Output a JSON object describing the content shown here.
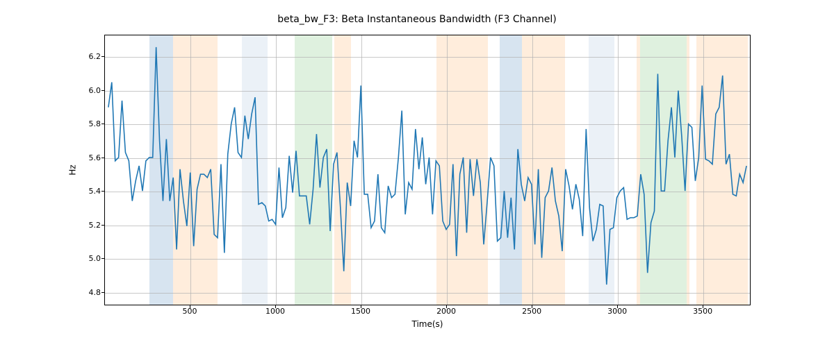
{
  "chart_data": {
    "type": "line",
    "title": "beta_bw_F3: Beta Instantaneous Bandwidth (F3 Channel)",
    "xlabel": "Time(s)",
    "ylabel": "Hz",
    "xlim": [
      0,
      3780
    ],
    "ylim": [
      4.72,
      6.33
    ],
    "xticks": [
      500,
      1000,
      1500,
      2000,
      2500,
      3000,
      3500
    ],
    "yticks": [
      4.8,
      5.0,
      5.2,
      5.4,
      5.6,
      5.8,
      6.0,
      6.2
    ],
    "grid": true,
    "bands": [
      {
        "x0": 260,
        "x1": 400,
        "color": "#a7c4de"
      },
      {
        "x0": 400,
        "x1": 660,
        "color": "#ffd8b1"
      },
      {
        "x0": 800,
        "x1": 950,
        "color": "#d3dfee"
      },
      {
        "x0": 1110,
        "x1": 1330,
        "color": "#b8e0b8"
      },
      {
        "x0": 1340,
        "x1": 1440,
        "color": "#ffd8b1"
      },
      {
        "x0": 1940,
        "x1": 2240,
        "color": "#ffd8b1"
      },
      {
        "x0": 2310,
        "x1": 2440,
        "color": "#a7c4de"
      },
      {
        "x0": 2440,
        "x1": 2690,
        "color": "#ffd8b1"
      },
      {
        "x0": 2830,
        "x1": 2980,
        "color": "#d3dfee"
      },
      {
        "x0": 3110,
        "x1": 3130,
        "color": "#ffd8b1"
      },
      {
        "x0": 3130,
        "x1": 3400,
        "color": "#b8e0b8"
      },
      {
        "x0": 3400,
        "x1": 3420,
        "color": "#ffd8b1"
      },
      {
        "x0": 3460,
        "x1": 3760,
        "color": "#ffd8b1"
      }
    ],
    "x": [
      20,
      40,
      60,
      80,
      100,
      120,
      140,
      160,
      180,
      200,
      220,
      240,
      260,
      280,
      300,
      320,
      340,
      360,
      380,
      400,
      420,
      440,
      460,
      480,
      500,
      520,
      540,
      560,
      580,
      600,
      620,
      640,
      660,
      680,
      700,
      720,
      740,
      760,
      780,
      800,
      820,
      840,
      860,
      880,
      900,
      920,
      940,
      960,
      980,
      1000,
      1020,
      1040,
      1060,
      1080,
      1100,
      1120,
      1140,
      1160,
      1180,
      1200,
      1220,
      1240,
      1260,
      1280,
      1300,
      1320,
      1340,
      1360,
      1380,
      1400,
      1420,
      1440,
      1460,
      1480,
      1500,
      1520,
      1540,
      1560,
      1580,
      1600,
      1620,
      1640,
      1660,
      1680,
      1700,
      1720,
      1740,
      1760,
      1780,
      1800,
      1820,
      1840,
      1860,
      1880,
      1900,
      1920,
      1940,
      1960,
      1980,
      2000,
      2020,
      2040,
      2060,
      2080,
      2100,
      2120,
      2140,
      2160,
      2180,
      2200,
      2220,
      2240,
      2260,
      2280,
      2300,
      2320,
      2340,
      2360,
      2380,
      2400,
      2420,
      2440,
      2460,
      2480,
      2500,
      2520,
      2540,
      2560,
      2580,
      2600,
      2620,
      2640,
      2660,
      2680,
      2700,
      2720,
      2740,
      2760,
      2780,
      2800,
      2820,
      2840,
      2860,
      2880,
      2900,
      2920,
      2940,
      2960,
      2980,
      3000,
      3020,
      3040,
      3060,
      3080,
      3100,
      3120,
      3140,
      3160,
      3180,
      3200,
      3220,
      3240,
      3260,
      3280,
      3300,
      3320,
      3340,
      3360,
      3380,
      3400,
      3420,
      3440,
      3460,
      3480,
      3500,
      3520,
      3540,
      3560,
      3580,
      3600,
      3620,
      3640,
      3660,
      3680,
      3700,
      3720,
      3740,
      3760
    ],
    "y": [
      5.9,
      6.05,
      5.58,
      5.6,
      5.94,
      5.63,
      5.58,
      5.34,
      5.46,
      5.55,
      5.4,
      5.58,
      5.6,
      5.6,
      6.26,
      5.7,
      5.34,
      5.71,
      5.34,
      5.48,
      5.05,
      5.53,
      5.34,
      5.19,
      5.51,
      5.07,
      5.41,
      5.5,
      5.5,
      5.48,
      5.53,
      5.14,
      5.12,
      5.56,
      5.03,
      5.62,
      5.8,
      5.9,
      5.63,
      5.6,
      5.85,
      5.71,
      5.86,
      5.96,
      5.32,
      5.33,
      5.31,
      5.22,
      5.23,
      5.2,
      5.54,
      5.24,
      5.3,
      5.61,
      5.39,
      5.64,
      5.37,
      5.37,
      5.37,
      5.2,
      5.41,
      5.74,
      5.42,
      5.6,
      5.65,
      5.16,
      5.56,
      5.63,
      5.3,
      4.92,
      5.45,
      5.31,
      5.7,
      5.6,
      6.03,
      5.38,
      5.38,
      5.18,
      5.22,
      5.5,
      5.18,
      5.15,
      5.43,
      5.36,
      5.38,
      5.6,
      5.88,
      5.26,
      5.45,
      5.41,
      5.77,
      5.53,
      5.72,
      5.44,
      5.6,
      5.26,
      5.58,
      5.55,
      5.22,
      5.17,
      5.2,
      5.56,
      5.01,
      5.5,
      5.6,
      5.15,
      5.59,
      5.37,
      5.59,
      5.45,
      5.08,
      5.33,
      5.6,
      5.55,
      5.1,
      5.12,
      5.4,
      5.12,
      5.36,
      5.05,
      5.65,
      5.44,
      5.34,
      5.48,
      5.44,
      5.08,
      5.53,
      5.0,
      5.36,
      5.4,
      5.54,
      5.34,
      5.25,
      5.04,
      5.53,
      5.43,
      5.29,
      5.44,
      5.35,
      5.13,
      5.77,
      5.3,
      5.1,
      5.17,
      5.32,
      5.31,
      4.84,
      5.17,
      5.18,
      5.36,
      5.4,
      5.42,
      5.23,
      5.24,
      5.24,
      5.25,
      5.5,
      5.38,
      4.91,
      5.21,
      5.28,
      6.1,
      5.4,
      5.4,
      5.7,
      5.9,
      5.6,
      6.0,
      5.73,
      5.4,
      5.8,
      5.78,
      5.46,
      5.6,
      6.03,
      5.59,
      5.58,
      5.56,
      5.86,
      5.9,
      6.09,
      5.56,
      5.62,
      5.38,
      5.37,
      5.5,
      5.45,
      5.55
    ]
  }
}
